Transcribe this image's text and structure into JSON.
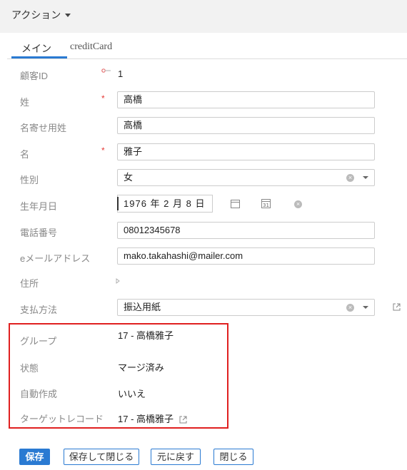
{
  "action_menu": {
    "label": "アクション"
  },
  "tabs": [
    {
      "label": "メイン",
      "active": true
    },
    {
      "label": "creditCard",
      "active": false
    }
  ],
  "fields": {
    "customer_id": {
      "label": "顧客ID",
      "value": "1"
    },
    "last_name": {
      "label": "姓",
      "value": "高橋",
      "required": true
    },
    "last_name_sort": {
      "label": "名寄せ用姓",
      "value": "高橋"
    },
    "first_name": {
      "label": "名",
      "value": "雅子",
      "required": true
    },
    "gender": {
      "label": "性別",
      "value": "女"
    },
    "birthdate": {
      "label": "生年月日",
      "value": "1976 年 2 月 8 日"
    },
    "phone": {
      "label": "電話番号",
      "value": "08012345678"
    },
    "email": {
      "label": "eメールアドレス",
      "value": "mako.takahashi@mailer.com"
    },
    "address": {
      "label": "住所"
    },
    "payment": {
      "label": "支払方法",
      "value": "振込用紙"
    },
    "group": {
      "label": "グループ",
      "value": "17 - 高橋雅子"
    },
    "status": {
      "label": "状態",
      "value": "マージ済み"
    },
    "auto_created": {
      "label": "自動作成",
      "value": "いいえ"
    },
    "target_record": {
      "label": "ターゲットレコード",
      "value": "17 - 高橋雅子"
    }
  },
  "buttons": {
    "save": "保存",
    "save_close": "保存して閉じる",
    "revert": "元に戻す",
    "close": "閉じる"
  },
  "colors": {
    "accent": "#2a7ad2",
    "required": "#e53935",
    "highlight": "#e02020"
  }
}
